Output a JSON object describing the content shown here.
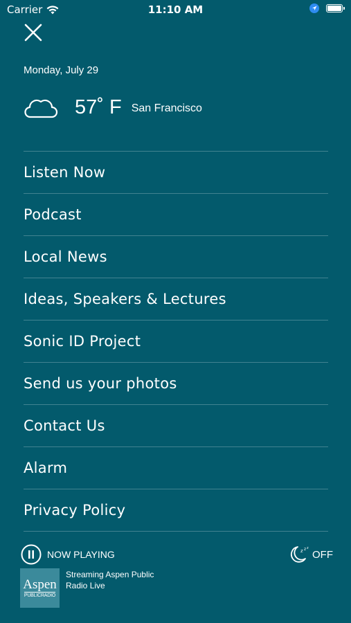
{
  "status_bar": {
    "carrier": "Carrier",
    "time": "11:10 AM"
  },
  "icons": [
    "close-icon",
    "cloud-icon",
    "pause-icon",
    "sleep-timer-icon",
    "wifi-icon",
    "location-icon",
    "battery-icon"
  ],
  "header": {
    "date": "Monday, July 29",
    "temperature": "57˚ F",
    "city": "San Francisco"
  },
  "menu": {
    "items": [
      {
        "label": "Listen Now"
      },
      {
        "label": "Podcast"
      },
      {
        "label": "Local News"
      },
      {
        "label": "Ideas, Speakers & Lectures"
      },
      {
        "label": "Sonic ID Project"
      },
      {
        "label": "Send us your photos"
      },
      {
        "label": "Contact Us"
      },
      {
        "label": "Alarm"
      },
      {
        "label": "Privacy Policy"
      }
    ]
  },
  "player": {
    "now_playing_label": "NOW PLAYING",
    "sleep_label": "OFF",
    "logo_text": "Aspen",
    "logo_subtext": "PUBLICRADIO",
    "description": "Streaming Aspen Public Radio Live"
  },
  "colors": {
    "background": "#035a6c",
    "logo_background": "#3b8a9b",
    "text": "#ffffff"
  }
}
